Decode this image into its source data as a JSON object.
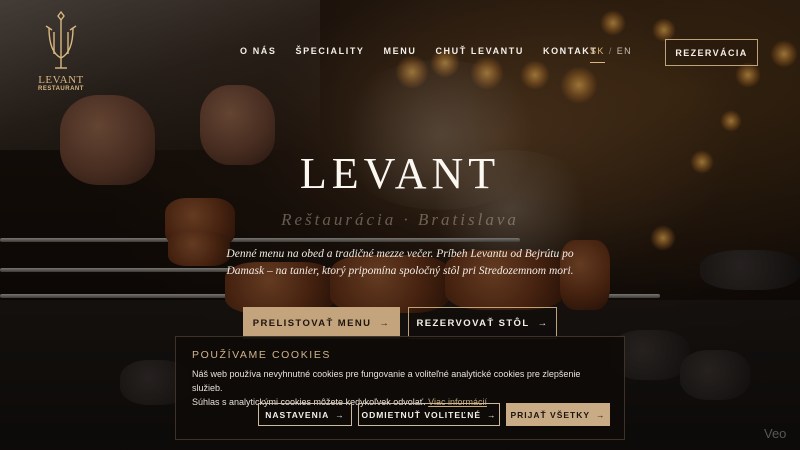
{
  "logo": {
    "name": "LEVANT",
    "subtitle": "RESTAURANT"
  },
  "nav": {
    "items": [
      {
        "label": "O NÁS"
      },
      {
        "label": "ŠPECIALITY"
      },
      {
        "label": "MENU"
      },
      {
        "label": "CHUŤ LEVANTU"
      },
      {
        "label": "KONTAKT"
      }
    ],
    "languages": {
      "active": "SK",
      "separator": "/",
      "other": "EN"
    },
    "reserve_label": "REZERVÁCIA"
  },
  "hero": {
    "title": "LEVANT",
    "subtitle": "Reštaurácia · Bratislava",
    "description": "Denné menu na obed a tradičné mezze večer. Príbeh Levantu od Bejrútu po Damask – na tanier, ktorý pripomína spoločný stôl pri Stredozemnom mori.",
    "cta_primary": "PRELISTOVAŤ MENU",
    "cta_secondary": "REZERVOVAŤ STÔL",
    "arrow": "→"
  },
  "cookie": {
    "title": "POUŽÍVAME COOKIES",
    "text_line1": "Náš web používa nevyhnutné cookies pre fungovanie a voliteľné analytické cookies pre zlepšenie služieb.",
    "text_line2": "Súhlas s analytickými cookies môžete kedykoľvek odvolať.",
    "link": "Viac informácií",
    "settings_label": "NASTAVENIA",
    "reject_label": "ODMIETNUŤ VOLITEĽNÉ",
    "accept_label": "PRIJAŤ VŠETKY",
    "arrow": "→"
  },
  "watermark": "Veo",
  "colors": {
    "accent": "#c3a47d",
    "background": "#0d0907",
    "text": "#f4efe8"
  }
}
